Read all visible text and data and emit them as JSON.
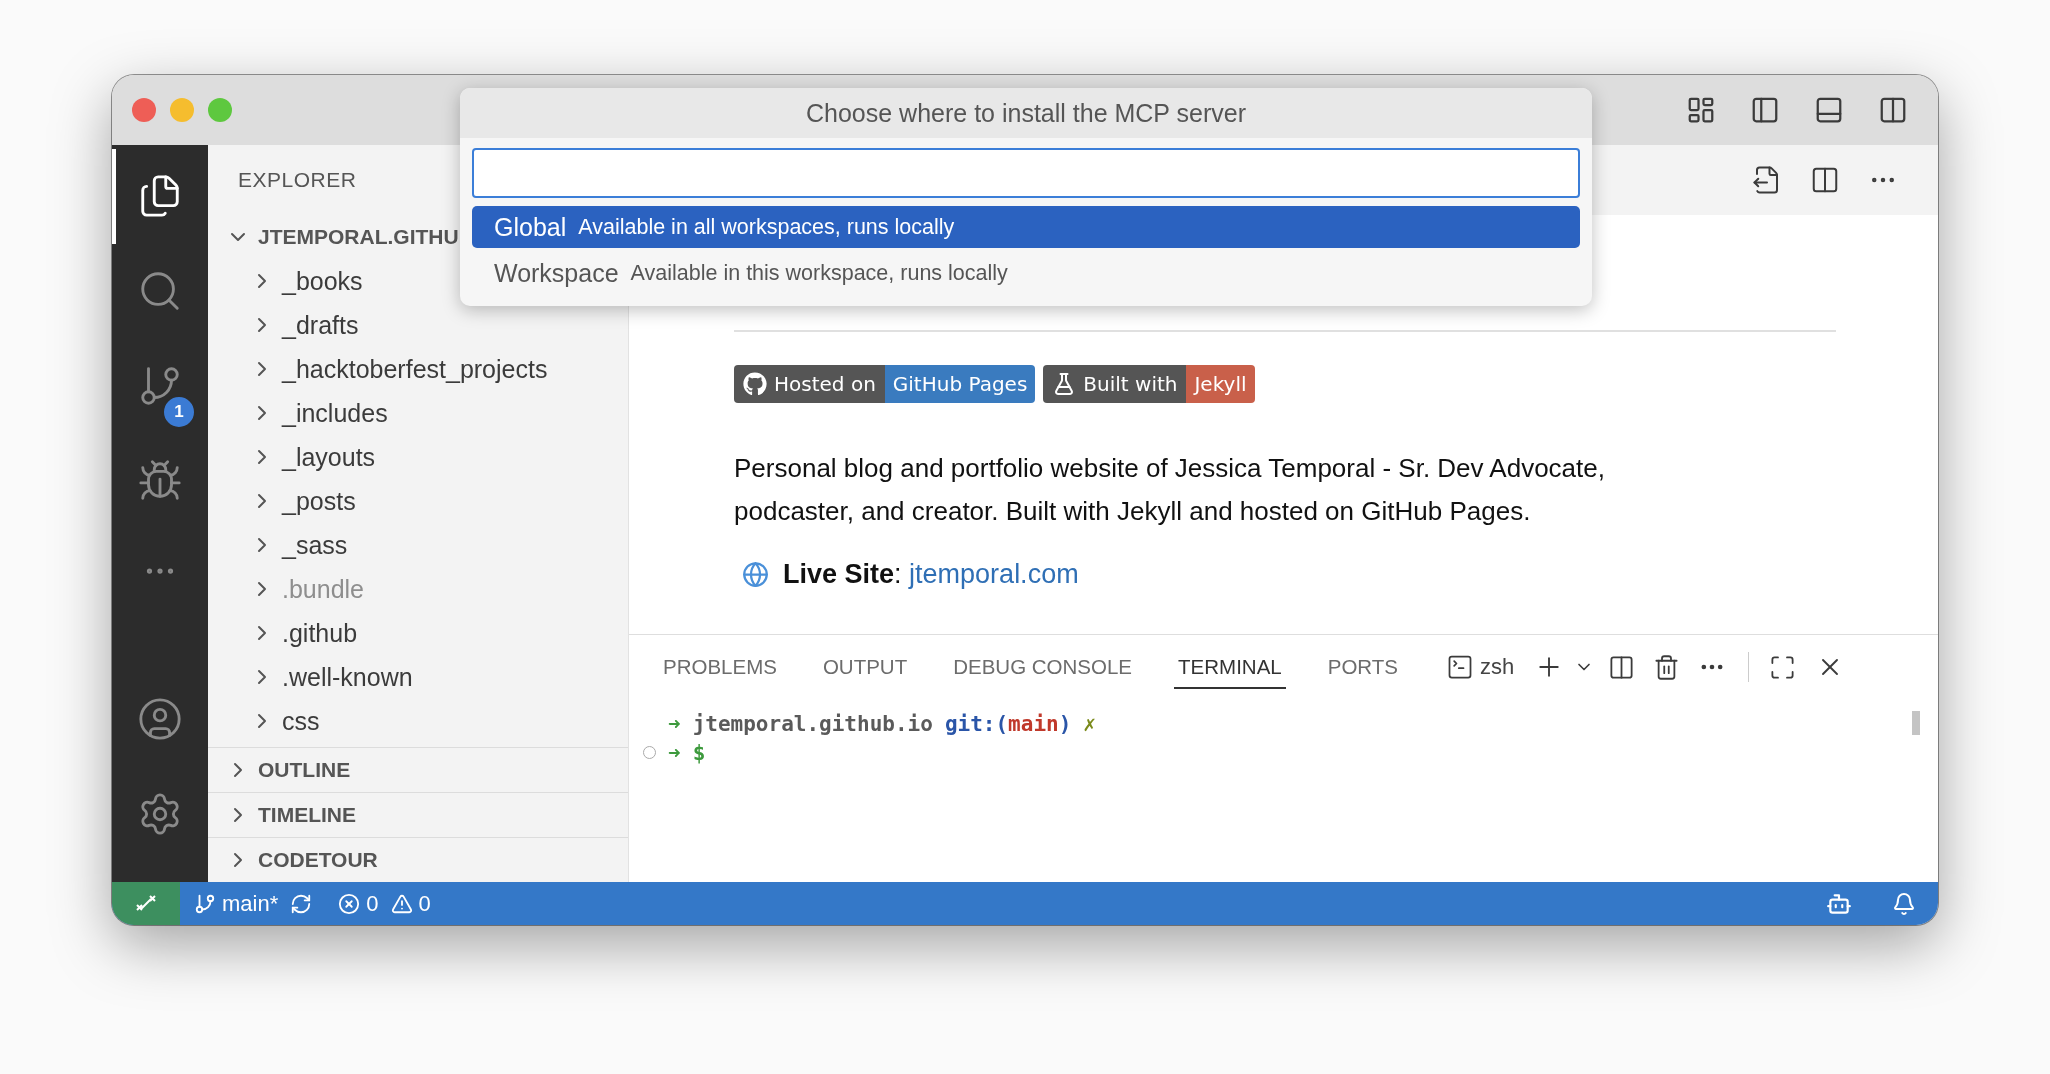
{
  "window": {
    "layout_icons": [
      {
        "kind": "customize-layout"
      },
      {
        "kind": "toggle-sidebar"
      },
      {
        "kind": "toggle-panel"
      },
      {
        "kind": "toggle-secondary-sidebar"
      }
    ]
  },
  "activity_bar": {
    "items": [
      {
        "kind": "explorer",
        "selected": true
      },
      {
        "kind": "search",
        "selected": false
      },
      {
        "kind": "source-control",
        "selected": false,
        "badge": "1"
      },
      {
        "kind": "run-debug",
        "selected": false
      },
      {
        "kind": "more",
        "selected": false
      }
    ],
    "bottom": [
      {
        "kind": "account"
      },
      {
        "kind": "settings"
      }
    ]
  },
  "sidebar": {
    "title": "EXPLORER",
    "root": {
      "label": "JTEMPORAL.GITHU",
      "expanded": true,
      "children": [
        {
          "label": "_books",
          "dimmed": false
        },
        {
          "label": "_drafts",
          "dimmed": false
        },
        {
          "label": "_hacktoberfest_projects",
          "dimmed": false
        },
        {
          "label": "_includes",
          "dimmed": false
        },
        {
          "label": "_layouts",
          "dimmed": false
        },
        {
          "label": "_posts",
          "dimmed": false
        },
        {
          "label": "_sass",
          "dimmed": false
        },
        {
          "label": ".bundle",
          "dimmed": true
        },
        {
          "label": ".github",
          "dimmed": false
        },
        {
          "label": ".well-known",
          "dimmed": false
        },
        {
          "label": "css",
          "dimmed": false
        }
      ]
    },
    "sections": [
      {
        "label": "OUTLINE",
        "expanded": false
      },
      {
        "label": "TIMELINE",
        "expanded": false
      },
      {
        "label": "CODETOUR",
        "expanded": false
      }
    ]
  },
  "editor": {
    "badges": [
      {
        "kind": "github",
        "label": "Hosted on",
        "value": "GitHub Pages",
        "color": "#3a7bbf"
      },
      {
        "kind": "flask",
        "label": "Built with",
        "value": "Jekyll",
        "color": "#c9604a"
      }
    ],
    "paragraph": "Personal blog and portfolio website of Jessica Temporal - Sr. Dev Advocate, podcaster, and creator. Built with Jekyll and hosted on GitHub Pages.",
    "live_site": {
      "text": "**Live Site**:",
      "link": "jtemporal.com"
    }
  },
  "panel": {
    "tabs": [
      {
        "label": "PROBLEMS",
        "selected": false
      },
      {
        "label": "OUTPUT",
        "selected": false
      },
      {
        "label": "DEBUG CONSOLE",
        "selected": false
      },
      {
        "label": "TERMINAL",
        "selected": true
      },
      {
        "label": "PORTS",
        "selected": false
      }
    ],
    "terminal_profile": "zsh",
    "terminal": [
      {
        "finished": false,
        "segments": [
          {
            "kind": "arrow",
            "text": "➜"
          },
          {
            "kind": "path",
            "text": "jtemporal.github.io"
          },
          {
            "kind": "git",
            "text": "git:("
          },
          {
            "kind": "branch",
            "text": "main"
          },
          {
            "kind": "git",
            "text": ")"
          },
          {
            "kind": "dirty",
            "text": "✗"
          }
        ]
      },
      {
        "finished": true,
        "segments": [
          {
            "kind": "arrow",
            "text": "➜"
          },
          {
            "kind": "arrow",
            "text": "$"
          }
        ]
      }
    ]
  },
  "status_bar": {
    "branch": "main*",
    "errors": "0",
    "warnings": "0"
  },
  "quick_pick": {
    "title": "Choose where to install the MCP server",
    "options": [
      {
        "label": "Global",
        "description": "Available in all workspaces, runs locally",
        "selected": true
      },
      {
        "label": "Workspace",
        "description": "Available in this workspace, runs locally",
        "selected": false
      }
    ]
  }
}
